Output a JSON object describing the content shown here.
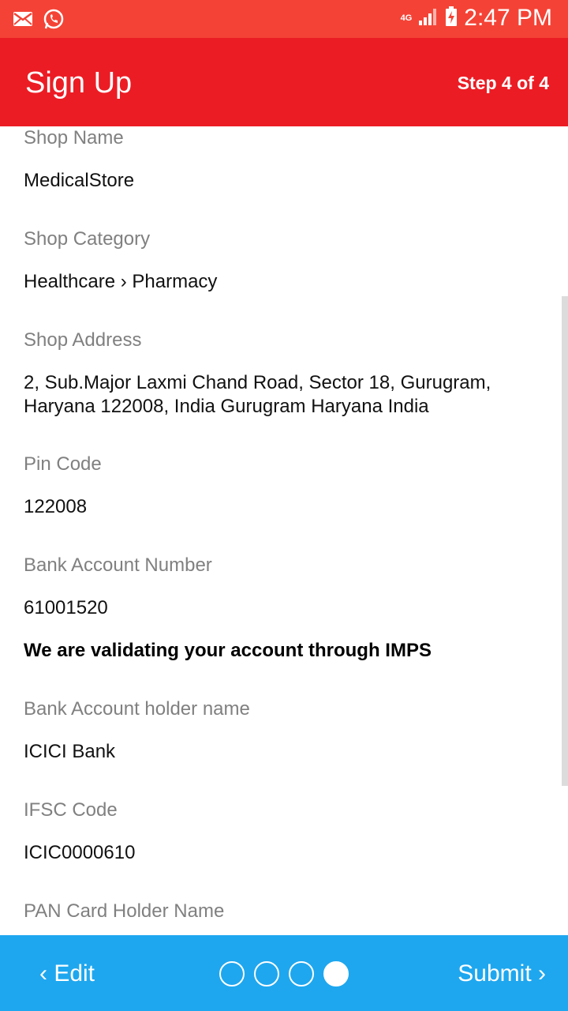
{
  "status_bar": {
    "time": "2:47 PM",
    "network": "4G",
    "icons": [
      "mail-icon",
      "whatsapp-icon",
      "signal-icon",
      "battery-charging-icon"
    ],
    "background": "#f44336"
  },
  "app_bar": {
    "title": "Sign Up",
    "step": "Step 4 of 4",
    "background": "#ec1c24"
  },
  "fields": {
    "shop_name": {
      "label": "Shop Name",
      "value": "MedicalStore"
    },
    "shop_category": {
      "label": "Shop Category",
      "value": "Healthcare › Pharmacy"
    },
    "shop_address": {
      "label": "Shop Address",
      "value": "2, Sub.Major Laxmi Chand Road, Sector 18, Gurugram, Haryana 122008, India Gurugram Haryana India"
    },
    "pin_code": {
      "label": "Pin Code",
      "value": "122008"
    },
    "bank_account_number": {
      "label": "Bank Account Number",
      "value": "61001520"
    },
    "validation_note": "We are validating your account through IMPS",
    "bank_account_holder": {
      "label": "Bank Account holder name",
      "value": "ICICI Bank"
    },
    "ifsc_code": {
      "label": "IFSC Code",
      "value": "ICIC0000610"
    },
    "pan_card_holder": {
      "label": "PAN Card Holder Name"
    }
  },
  "bottom_bar": {
    "edit_label": "‹ Edit",
    "submit_label": "Submit ›",
    "current_step": 4,
    "total_steps": 4,
    "background": "#1ea7ef"
  }
}
